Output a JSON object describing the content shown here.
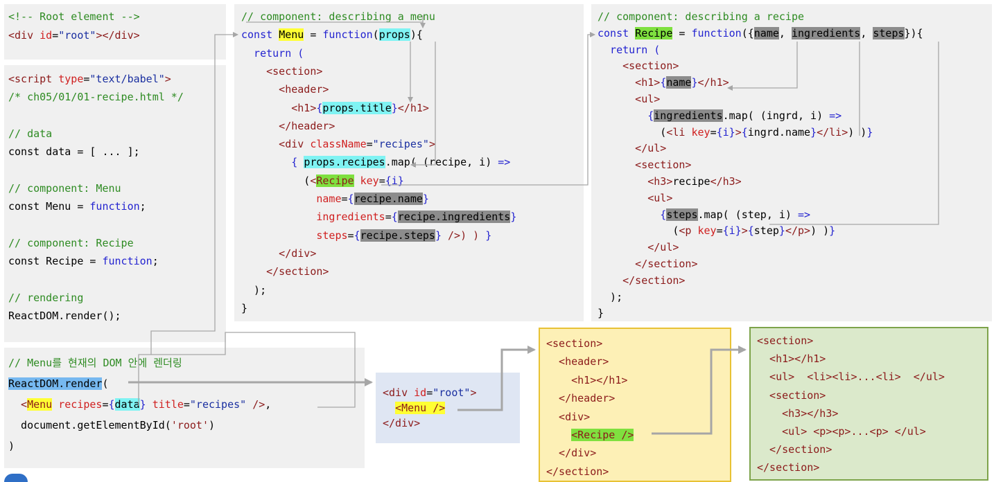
{
  "root_box": {
    "lines": [
      [
        {
          "t": "<!-- Root element -->",
          "c": "c"
        }
      ],
      [
        {
          "t": "<div ",
          "c": "t"
        },
        {
          "t": "id",
          "c": "a"
        },
        {
          "t": "=",
          "c": "p"
        },
        {
          "t": "\"root\"",
          "c": "s"
        },
        {
          "t": "></div>",
          "c": "t"
        }
      ]
    ]
  },
  "script_box": {
    "lines": [
      [
        {
          "t": "<script ",
          "c": "t"
        },
        {
          "t": "type",
          "c": "a"
        },
        {
          "t": "=",
          "c": "p"
        },
        {
          "t": "\"text/babel\"",
          "c": "s"
        },
        {
          "t": ">",
          "c": "t"
        }
      ],
      [
        {
          "t": "/* ch05/01/01-recipe.html */",
          "c": "c"
        }
      ],
      [],
      [
        {
          "t": "// data",
          "c": "c"
        }
      ],
      [
        {
          "t": "const data = [ ... ];",
          "c": "p"
        }
      ],
      [],
      [
        {
          "t": "// component: Menu",
          "c": "c"
        }
      ],
      [
        {
          "t": "const Menu = ",
          "c": "p"
        },
        {
          "t": "function",
          "c": "k"
        },
        {
          "t": ";",
          "c": "p"
        }
      ],
      [],
      [
        {
          "t": "// component: Recipe",
          "c": "c"
        }
      ],
      [
        {
          "t": "const Recipe = ",
          "c": "p"
        },
        {
          "t": "function",
          "c": "k"
        },
        {
          "t": ";",
          "c": "p"
        }
      ],
      [],
      [
        {
          "t": "// rendering",
          "c": "c"
        }
      ],
      [
        {
          "t": "ReactDOM.render();",
          "c": "p"
        }
      ]
    ]
  },
  "menu_box": {
    "lines": [
      [
        {
          "t": "// component: describing a menu",
          "c": "c"
        }
      ],
      [
        {
          "t": "const ",
          "c": "k"
        },
        {
          "t": "Menu",
          "c": "p",
          "h": "hy"
        },
        {
          "t": " = ",
          "c": "p"
        },
        {
          "t": "function",
          "c": "k"
        },
        {
          "t": "(",
          "c": "p"
        },
        {
          "t": "props",
          "c": "p",
          "h": "hc"
        },
        {
          "t": "){",
          "c": "p"
        }
      ],
      [
        {
          "t": "  return (",
          "c": "k"
        }
      ],
      [
        {
          "t": "    <section>",
          "c": "t"
        }
      ],
      [
        {
          "t": "      <header>",
          "c": "t"
        }
      ],
      [
        {
          "t": "        <h1>",
          "c": "t"
        },
        {
          "t": "{",
          "c": "k"
        },
        {
          "t": "props.title",
          "c": "p",
          "h": "hc"
        },
        {
          "t": "}",
          "c": "k"
        },
        {
          "t": "</h1>",
          "c": "t"
        }
      ],
      [
        {
          "t": "      </header>",
          "c": "t"
        }
      ],
      [
        {
          "t": "      <div ",
          "c": "t"
        },
        {
          "t": "className",
          "c": "a"
        },
        {
          "t": "=",
          "c": "p"
        },
        {
          "t": "\"recipes\"",
          "c": "s"
        },
        {
          "t": ">",
          "c": "t"
        }
      ],
      [
        {
          "t": "        { ",
          "c": "k"
        },
        {
          "t": "props.recipes",
          "c": "p",
          "h": "hc"
        },
        {
          "t": ".map( (recipe, i) ",
          "c": "p"
        },
        {
          "t": "=>",
          "c": "k"
        }
      ],
      [
        {
          "t": "          (",
          "c": "p"
        },
        {
          "t": "<",
          "c": "t"
        },
        {
          "t": "Recipe",
          "c": "t",
          "h": "hg"
        },
        {
          "t": " key",
          "c": "a"
        },
        {
          "t": "=",
          "c": "p"
        },
        {
          "t": "{i}",
          "c": "k"
        }
      ],
      [
        {
          "t": "            name",
          "c": "a"
        },
        {
          "t": "=",
          "c": "p"
        },
        {
          "t": "{",
          "c": "k"
        },
        {
          "t": "recipe.name",
          "c": "p",
          "h": "hd"
        },
        {
          "t": "}",
          "c": "k"
        }
      ],
      [
        {
          "t": "            ingredients",
          "c": "a"
        },
        {
          "t": "=",
          "c": "p"
        },
        {
          "t": "{",
          "c": "k"
        },
        {
          "t": "recipe.ingredients",
          "c": "p",
          "h": "hd"
        },
        {
          "t": "}",
          "c": "k"
        }
      ],
      [
        {
          "t": "            steps",
          "c": "a"
        },
        {
          "t": "=",
          "c": "p"
        },
        {
          "t": "{",
          "c": "k"
        },
        {
          "t": "recipe.steps",
          "c": "p",
          "h": "hd"
        },
        {
          "t": "}",
          "c": "k"
        },
        {
          "t": " />) ) ",
          "c": "t"
        },
        {
          "t": "}",
          "c": "k"
        }
      ],
      [
        {
          "t": "      </div>",
          "c": "t"
        }
      ],
      [
        {
          "t": "    </section>",
          "c": "t"
        }
      ],
      [
        {
          "t": "  );",
          "c": "p"
        }
      ],
      [
        {
          "t": "}",
          "c": "p"
        }
      ]
    ]
  },
  "recipe_box": {
    "lines": [
      [
        {
          "t": "// component: describing a recipe",
          "c": "c"
        }
      ],
      [
        {
          "t": "const ",
          "c": "k"
        },
        {
          "t": "Recipe",
          "c": "p",
          "h": "hg"
        },
        {
          "t": " = ",
          "c": "p"
        },
        {
          "t": "function",
          "c": "k"
        },
        {
          "t": "({",
          "c": "p"
        },
        {
          "t": "name",
          "c": "p",
          "h": "hd"
        },
        {
          "t": ", ",
          "c": "p"
        },
        {
          "t": "ingredients",
          "c": "p",
          "h": "hd"
        },
        {
          "t": ", ",
          "c": "p"
        },
        {
          "t": "steps",
          "c": "p",
          "h": "hd"
        },
        {
          "t": "}){",
          "c": "p"
        }
      ],
      [
        {
          "t": "  return (",
          "c": "k"
        }
      ],
      [
        {
          "t": "    <section>",
          "c": "t"
        }
      ],
      [
        {
          "t": "      <h1>",
          "c": "t"
        },
        {
          "t": "{",
          "c": "k"
        },
        {
          "t": "name",
          "c": "p",
          "h": "hd"
        },
        {
          "t": "}",
          "c": "k"
        },
        {
          "t": "</h1>",
          "c": "t"
        }
      ],
      [
        {
          "t": "      <ul>",
          "c": "t"
        }
      ],
      [
        {
          "t": "        {",
          "c": "k"
        },
        {
          "t": "ingredients",
          "c": "p",
          "h": "hd"
        },
        {
          "t": ".map( (ingrd, i) ",
          "c": "p"
        },
        {
          "t": "=>",
          "c": "k"
        }
      ],
      [
        {
          "t": "          (",
          "c": "p"
        },
        {
          "t": "<li ",
          "c": "t"
        },
        {
          "t": "key",
          "c": "a"
        },
        {
          "t": "=",
          "c": "p"
        },
        {
          "t": "{i}",
          "c": "k"
        },
        {
          "t": ">",
          "c": "t"
        },
        {
          "t": "{",
          "c": "k"
        },
        {
          "t": "ingrd.name",
          "c": "p"
        },
        {
          "t": "}",
          "c": "k"
        },
        {
          "t": "</li>",
          "c": "t"
        },
        {
          "t": ") )",
          "c": "p"
        },
        {
          "t": "}",
          "c": "k"
        }
      ],
      [
        {
          "t": "      </ul>",
          "c": "t"
        }
      ],
      [
        {
          "t": "      <section>",
          "c": "t"
        }
      ],
      [
        {
          "t": "        <h3>",
          "c": "t"
        },
        {
          "t": "recipe",
          "c": "p"
        },
        {
          "t": "</h3>",
          "c": "t"
        }
      ],
      [
        {
          "t": "        <ul>",
          "c": "t"
        }
      ],
      [
        {
          "t": "          {",
          "c": "k"
        },
        {
          "t": "steps",
          "c": "p",
          "h": "hd"
        },
        {
          "t": ".map( (step, i) ",
          "c": "p"
        },
        {
          "t": "=>",
          "c": "k"
        }
      ],
      [
        {
          "t": "            (",
          "c": "p"
        },
        {
          "t": "<p ",
          "c": "t"
        },
        {
          "t": "key",
          "c": "a"
        },
        {
          "t": "=",
          "c": "p"
        },
        {
          "t": "{i}",
          "c": "k"
        },
        {
          "t": ">",
          "c": "t"
        },
        {
          "t": "{",
          "c": "k"
        },
        {
          "t": "step",
          "c": "p"
        },
        {
          "t": "}",
          "c": "k"
        },
        {
          "t": "</p>",
          "c": "t"
        },
        {
          "t": ") )",
          "c": "p"
        },
        {
          "t": "}",
          "c": "k"
        }
      ],
      [
        {
          "t": "        </ul>",
          "c": "t"
        }
      ],
      [
        {
          "t": "      </section>",
          "c": "t"
        }
      ],
      [
        {
          "t": "    </section>",
          "c": "t"
        }
      ],
      [
        {
          "t": "  );",
          "c": "p"
        }
      ],
      [
        {
          "t": "}",
          "c": "p"
        }
      ]
    ]
  },
  "render_box": {
    "lines": [
      [
        {
          "t": "// Menu를 현재의 DOM 안에 렌더링",
          "c": "c"
        }
      ],
      [
        {
          "t": "ReactDOM.render",
          "c": "p",
          "h": "hb"
        },
        {
          "t": "(",
          "c": "p"
        }
      ],
      [
        {
          "t": "  <",
          "c": "t"
        },
        {
          "t": "Menu",
          "c": "t",
          "h": "hy"
        },
        {
          "t": " recipes",
          "c": "a"
        },
        {
          "t": "=",
          "c": "p"
        },
        {
          "t": "{",
          "c": "k"
        },
        {
          "t": "data",
          "c": "p",
          "h": "hc"
        },
        {
          "t": "}",
          "c": "k"
        },
        {
          "t": " title",
          "c": "a"
        },
        {
          "t": "=",
          "c": "p"
        },
        {
          "t": "\"recipes\"",
          "c": "s"
        },
        {
          "t": " />",
          "c": "t"
        },
        {
          "t": ",",
          "c": "p"
        }
      ],
      [
        {
          "t": "  document.getElementById(",
          "c": "p"
        },
        {
          "t": "'root'",
          "c": "t"
        },
        {
          "t": ")",
          "c": "p"
        }
      ],
      [
        {
          "t": ")",
          "c": "p"
        }
      ]
    ]
  },
  "dom_box": {
    "lines": [
      [
        {
          "t": "<div ",
          "c": "t"
        },
        {
          "t": "id",
          "c": "a"
        },
        {
          "t": "=",
          "c": "p"
        },
        {
          "t": "\"root\"",
          "c": "s"
        },
        {
          "t": ">",
          "c": "t"
        }
      ],
      [
        {
          "t": "  ",
          "c": "p"
        },
        {
          "t": "<Menu />",
          "c": "t",
          "h": "hy"
        }
      ],
      [
        {
          "t": "</div>",
          "c": "t"
        }
      ]
    ]
  },
  "menu_output_box": {
    "lines": [
      [
        {
          "t": "<section>",
          "c": "t"
        }
      ],
      [
        {
          "t": "  <header>",
          "c": "t"
        }
      ],
      [
        {
          "t": "    <h1></h1>",
          "c": "t"
        }
      ],
      [
        {
          "t": "  </header>",
          "c": "t"
        }
      ],
      [
        {
          "t": "  <div>",
          "c": "t"
        }
      ],
      [
        {
          "t": "    ",
          "c": "p"
        },
        {
          "t": "<Recipe />",
          "c": "t",
          "h": "hg"
        }
      ],
      [
        {
          "t": "  </div>",
          "c": "t"
        }
      ],
      [
        {
          "t": "</section>",
          "c": "t"
        }
      ]
    ]
  },
  "recipe_output_box": {
    "lines": [
      [
        {
          "t": "<section>",
          "c": "t"
        }
      ],
      [
        {
          "t": "  <h1></h1>",
          "c": "t"
        }
      ],
      [
        {
          "t": "  <ul>  <li><li>...<li>  </ul>",
          "c": "t"
        }
      ],
      [
        {
          "t": "  <section>",
          "c": "t"
        }
      ],
      [
        {
          "t": "    <h3></h3>",
          "c": "t"
        }
      ],
      [
        {
          "t": "    <ul> <p><p>...<p> </ul>",
          "c": "t"
        }
      ],
      [
        {
          "t": "  </section>",
          "c": "t"
        }
      ],
      [
        {
          "t": "</section>",
          "c": "t"
        }
      ]
    ]
  },
  "colors": {
    "panel_gray": "#f0f0f0",
    "dom_blue": "#dfe6f3",
    "menu_yellow": "#fdf0b6",
    "menu_yellow_border": "#e8c235",
    "recipe_green": "#dbe9cb",
    "recipe_green_border": "#7da34a",
    "wire": "#a6a6a6"
  }
}
